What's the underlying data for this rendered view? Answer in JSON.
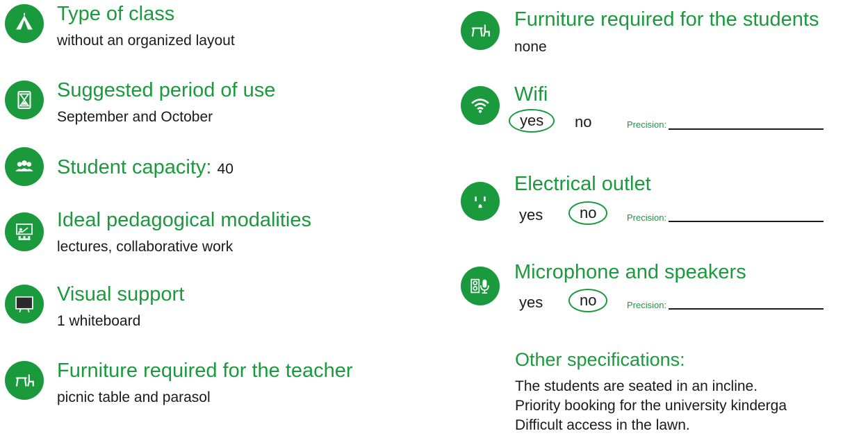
{
  "colors": {
    "accent": "#1a9a3c",
    "text": "#1a1a1a"
  },
  "left": {
    "type_of_class": {
      "icon": "tent-icon",
      "title": "Type of class",
      "value": "without an organized layout"
    },
    "period": {
      "icon": "hourglass-icon",
      "title": "Suggested period of use",
      "value": "September and October"
    },
    "capacity": {
      "icon": "group-icon",
      "title": "Student capacity:",
      "value": "40"
    },
    "modalities": {
      "icon": "teacher-icon",
      "title": "Ideal pedagogical modalities",
      "value": "lectures, collaborative work"
    },
    "visual": {
      "icon": "whiteboard-icon",
      "title": "Visual support",
      "value": "1 whiteboard"
    },
    "furniture_teacher": {
      "icon": "table-chair-icon",
      "title": "Furniture required for the teacher",
      "value": "picnic table and parasol"
    }
  },
  "right": {
    "furniture_students": {
      "icon": "table-chair-icon",
      "title": "Furniture required for the students",
      "value": "none"
    },
    "wifi": {
      "icon": "wifi-icon",
      "title": "Wifi",
      "yes": "yes",
      "no": "no",
      "selected": "yes",
      "precision_label": "Precision:"
    },
    "outlet": {
      "icon": "outlet-icon",
      "title": "Electrical outlet",
      "yes": "yes",
      "no": "no",
      "selected": "no",
      "precision_label": "Precision:"
    },
    "audio": {
      "icon": "speaker-mic-icon",
      "title": "Microphone and speakers",
      "yes": "yes",
      "no": "no",
      "selected": "no",
      "precision_label": "Precision:"
    },
    "other": {
      "title": "Other specifications:",
      "lines": [
        "The students are seated in an incline.",
        "Priority booking for the university kinderga",
        "Difficult access in the lawn."
      ]
    }
  }
}
